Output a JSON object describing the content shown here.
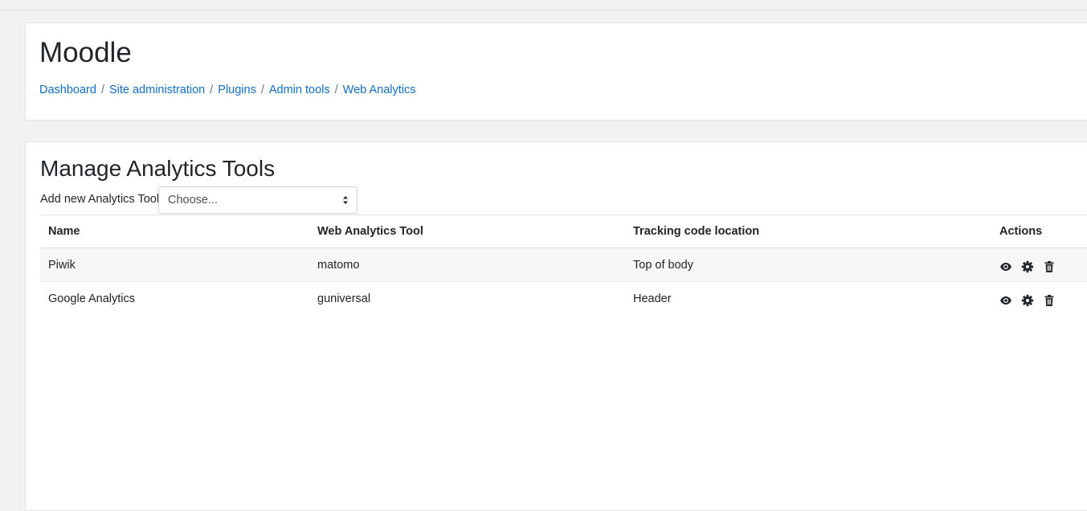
{
  "site": {
    "title": "Moodle"
  },
  "breadcrumb": [
    {
      "label": "Dashboard"
    },
    {
      "label": "Site administration"
    },
    {
      "label": "Plugins"
    },
    {
      "label": "Admin tools"
    },
    {
      "label": "Web Analytics"
    }
  ],
  "breadcrumb_separator": "/",
  "page": {
    "heading": "Manage Analytics Tools",
    "add_label": "Add new Analytics Tool",
    "add_select": {
      "value": "Choose..."
    }
  },
  "table": {
    "headers": {
      "name": "Name",
      "tool": "Web Analytics Tool",
      "location": "Tracking code location",
      "actions": "Actions"
    },
    "rows": [
      {
        "name": "Piwik",
        "tool": "matomo",
        "location": "Top of body",
        "actions": [
          "eye-icon",
          "gear-icon",
          "trash-icon"
        ]
      },
      {
        "name": "Google Analytics",
        "tool": "guniversal",
        "location": "Header",
        "actions": [
          "eye-icon",
          "gear-icon",
          "trash-icon"
        ]
      }
    ]
  },
  "colors": {
    "link": "#0f6fc5",
    "background": "#f2f2f2",
    "card": "#ffffff",
    "text": "#212529"
  }
}
